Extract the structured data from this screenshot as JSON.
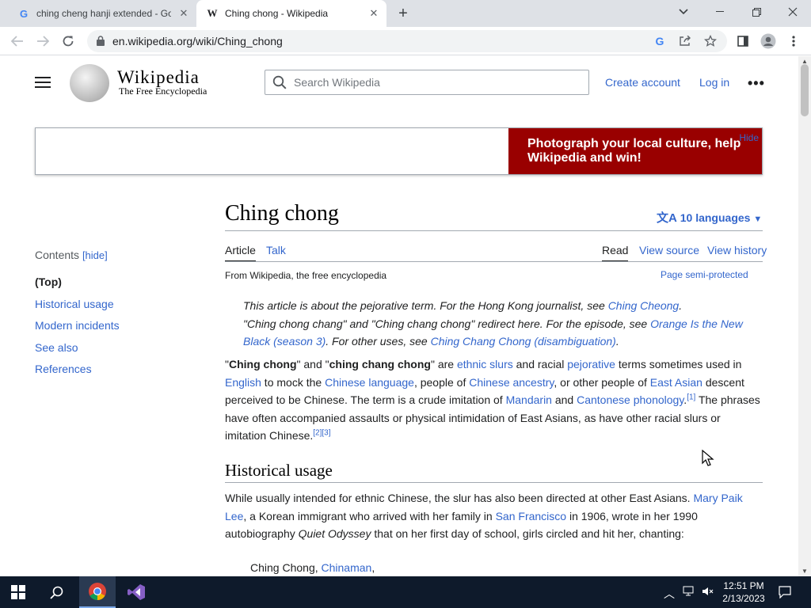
{
  "browser": {
    "tabs": [
      {
        "title": "ching cheng hanji extended - Go",
        "favicon": "google-g-icon"
      },
      {
        "title": "Ching chong - Wikipedia",
        "favicon": "wikipedia-w-icon"
      }
    ],
    "url": "en.wikipedia.org/wiki/Ching_chong",
    "favicon_letters": {
      "google": "G",
      "wikipedia": "W"
    }
  },
  "header": {
    "wordmark": "Wikipedia",
    "tagline": "The Free Encyclopedia",
    "search_placeholder": "Search Wikipedia",
    "create_account": "Create account",
    "log_in": "Log in"
  },
  "banner": {
    "message": "Photograph your local culture, help Wikipedia and win!",
    "hide": "Hide",
    "color": "#990000"
  },
  "toc": {
    "title": "Contents",
    "hide": "[hide]",
    "items": [
      "(Top)",
      "Historical usage",
      "Modern incidents",
      "See also",
      "References"
    ]
  },
  "article": {
    "title": "Ching chong",
    "languages": "10 languages",
    "tabs": {
      "article": "Article",
      "talk": "Talk",
      "read": "Read",
      "view_source": "View source",
      "view_history": "View history"
    },
    "from": "From Wikipedia, the free encyclopedia",
    "protection": "Page semi-protected",
    "hatnote1": {
      "text": "This article is about the pejorative term. For the Hong Kong journalist, see ",
      "link": "Ching Cheong",
      "end": "."
    },
    "hatnote2": {
      "t1": "\"Ching chong chang\" and \"Ching chang chong\" redirect here. For the episode, see ",
      "l1": "Orange Is the New Black (season 3)",
      "t2": ". For other uses, see ",
      "l2": "Ching Chang Chong (disambiguation)",
      "t3": "."
    },
    "lead": {
      "q1": "\"",
      "b1": "Ching chong",
      "t1": "\" and \"",
      "b2": "ching chang chong",
      "t2": "\" are ",
      "l1": "ethnic slurs",
      "t3": " and racial ",
      "l2": "pejorative",
      "t4": " terms sometimes used in ",
      "l3": "English",
      "t5": " to mock the ",
      "l4": "Chinese language",
      "t6": ", people of ",
      "l5": "Chinese ancestry",
      "t7": ", or other people of ",
      "l6": "East Asian",
      "t8": " descent perceived to be Chinese. The term is a crude imitation of ",
      "l7": "Mandarin",
      "t9": " and ",
      "l8": "Cantonese phonology",
      "t10": ".",
      "ref1": "[1]",
      "t11": " The phrases have often accompanied assaults or physical intimidation of East Asians, as have other racial slurs or imitation Chinese.",
      "ref2": "[2]",
      "ref3": "[3]"
    },
    "section1": {
      "heading": "Historical usage",
      "t1": "While usually intended for ethnic Chinese, the slur has also been directed at other East Asians. ",
      "l1": "Mary Paik Lee",
      "t2": ", a Korean immigrant who arrived with her family in ",
      "l2": "San Francisco",
      "t3": " in 1906, wrote in her 1990 autobiography ",
      "i1": "Quiet Odyssey",
      "t4": " that on her first day of school, girls circled and hit her, chanting:"
    },
    "quote": {
      "t1": "Ching Chong, ",
      "l1": "Chinaman",
      "t2": ","
    }
  },
  "taskbar": {
    "time": "12:51 PM",
    "date": "2/13/2023"
  }
}
